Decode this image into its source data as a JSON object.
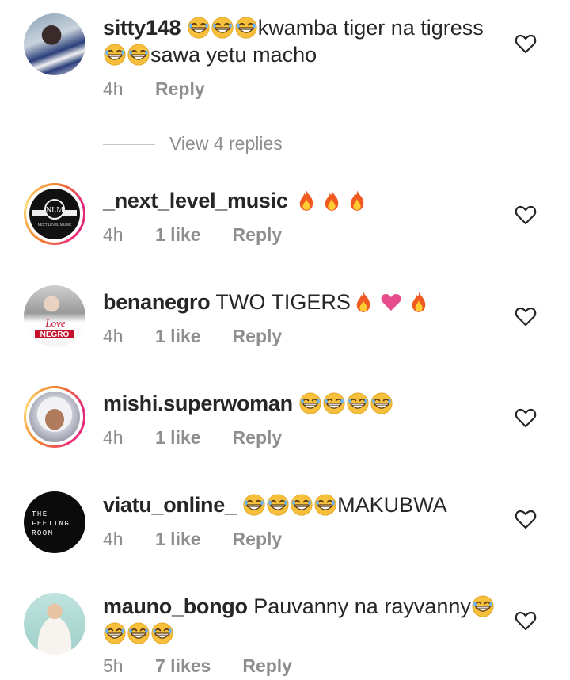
{
  "comments": [
    {
      "username": "sitty148",
      "text_a": "kwamba tiger na tigress",
      "text_b": "sawa yetu macho",
      "time": "4h",
      "likes": "",
      "reply": "Reply"
    },
    {
      "username": "_next_level_music",
      "time": "4h",
      "likes": "1 like",
      "reply": "Reply",
      "avatar_logo_text": "NLM",
      "avatar_caption": "NEXT LEVEL MUSIC"
    },
    {
      "username": "benanegro",
      "text_a": "TWO TIGERS",
      "time": "4h",
      "likes": "1 like",
      "reply": "Reply",
      "avatar_text_a": "Love",
      "avatar_text_b": "NEGRO"
    },
    {
      "username": "mishi.superwoman",
      "time": "4h",
      "likes": "1 like",
      "reply": "Reply"
    },
    {
      "username": "viatu_online_",
      "text_a": "MAKUBWA",
      "time": "4h",
      "likes": "1 like",
      "reply": "Reply",
      "avatar_line1": "THE",
      "avatar_line2": "FEETING",
      "avatar_line3": "ROOM"
    },
    {
      "username": "mauno_bongo",
      "text_a": "Pauvanny na rayvanny",
      "time": "5h",
      "likes": "7 likes",
      "reply": "Reply"
    }
  ],
  "view_replies": "View 4 replies",
  "icons": {
    "like": "heart-outline-icon",
    "laugh": "grinning-squinting-emoji",
    "fire": "fire-emoji",
    "heart": "pink-heart-emoji"
  },
  "colors": {
    "text": "#262626",
    "secondary": "#8e8e8e",
    "story_ring_start": "#f58529",
    "story_ring_end": "#dd2a7b"
  }
}
